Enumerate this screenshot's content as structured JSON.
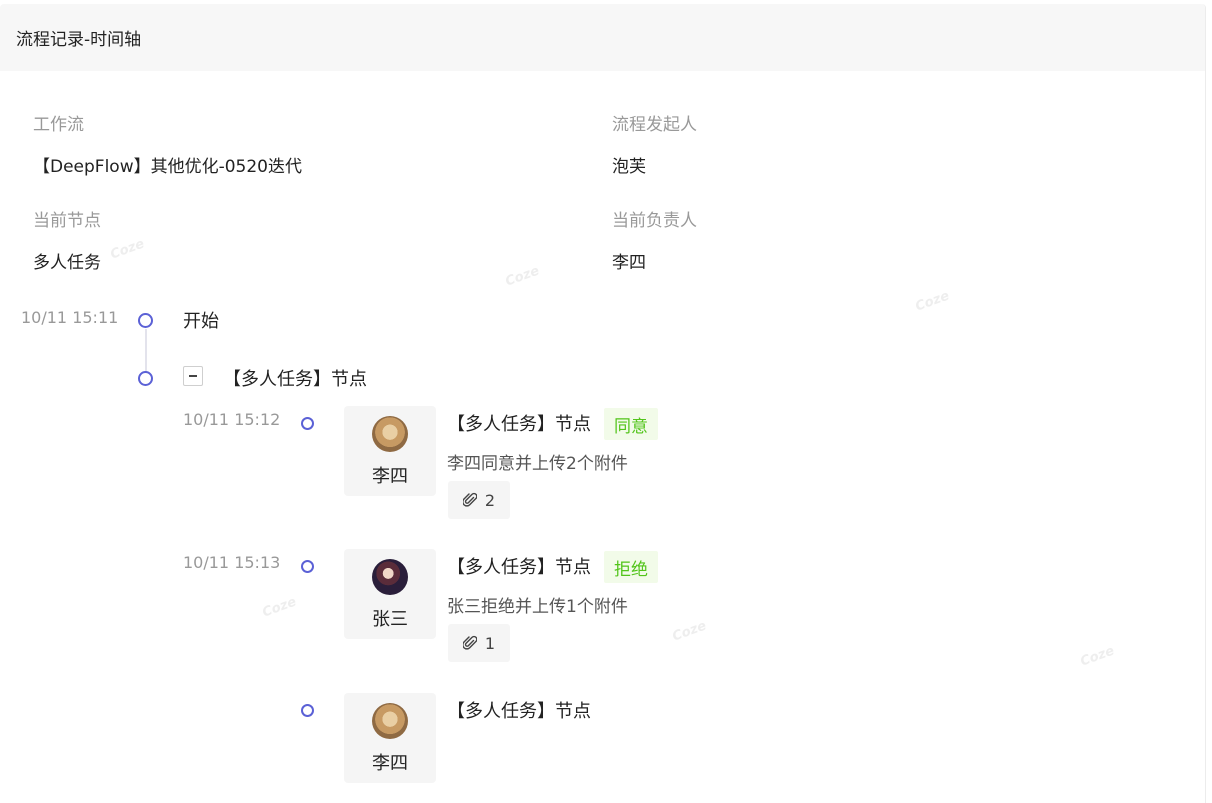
{
  "header": {
    "title": "流程记录-时间轴"
  },
  "info": {
    "workflow_label": "工作流",
    "workflow_value": "【DeepFlow】其他优化-0520迭代",
    "initiator_label": "流程发起人",
    "initiator_value": "泡芙",
    "current_node_label": "当前节点",
    "current_node_value": "多人任务",
    "current_owner_label": "当前负责人",
    "current_owner_value": "李四"
  },
  "timeline": {
    "start": {
      "time": "10/11 15:11",
      "label": "开始"
    },
    "node": {
      "label": "【多人任务】节点"
    },
    "records": [
      {
        "time": "10/11 15:12",
        "user": "李四",
        "avatar": "cat",
        "title": "【多人任务】节点",
        "status": "同意",
        "desc": "李四同意并上传2个附件",
        "attachments": "2"
      },
      {
        "time": "10/11 15:13",
        "user": "张三",
        "avatar": "person",
        "title": "【多人任务】节点",
        "status": "拒绝",
        "desc": "张三拒绝并上传1个附件",
        "attachments": "1"
      },
      {
        "time": "",
        "user": "李四",
        "avatar": "cat",
        "title": "【多人任务】节点"
      }
    ]
  },
  "colors": {
    "timeline_dot": "#5b61d6",
    "tag_text": "#52c41a",
    "tag_bg": "#f2fbe9"
  },
  "icons": {
    "attachment": "paperclip-icon",
    "collapse": "minus-square-icon"
  }
}
